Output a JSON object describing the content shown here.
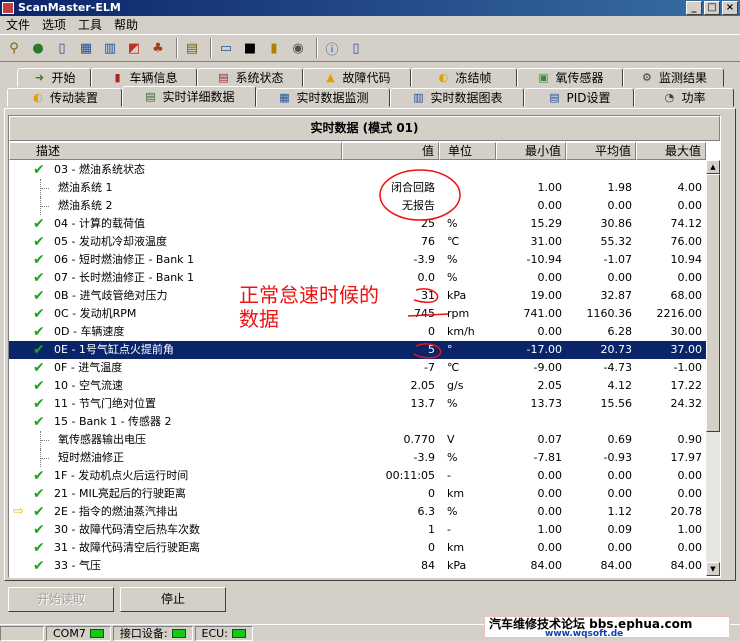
{
  "window": {
    "title": "ScanMaster-ELM",
    "minimize": "_",
    "maximize": "□",
    "close": "×"
  },
  "menu": [
    "文件",
    "选项",
    "工具",
    "帮助"
  ],
  "toolbar_icons": [
    "connect-icon",
    "globe-icon",
    "document-icon",
    "table-icon",
    "chart-icon",
    "tiles-icon",
    "engine-icon",
    "clipboard-icon",
    "monitor-icon",
    "terminal-icon",
    "battery-icon",
    "gauge-icon",
    "info-icon",
    "exit-icon"
  ],
  "tabs_row1": [
    {
      "label": "开始",
      "icon": "play-icon",
      "glyph": "➜",
      "color": "#3a7a2a"
    },
    {
      "label": "车辆信息",
      "icon": "info-card-icon",
      "glyph": "▮",
      "color": "#b02020"
    },
    {
      "label": "系统状态",
      "icon": "status-icon",
      "glyph": "▤",
      "color": "#b02020"
    },
    {
      "label": "故障代码",
      "icon": "warning-icon",
      "glyph": "▲",
      "color": "#e0a000"
    },
    {
      "label": "冻结帧",
      "icon": "freeze-frame-icon",
      "glyph": "◐",
      "color": "#e0a000"
    },
    {
      "label": "氧传感器",
      "icon": "sensor-icon",
      "glyph": "▣",
      "color": "#3a8a3a"
    },
    {
      "label": "监测结果",
      "icon": "monitor-result-icon",
      "glyph": "⚙",
      "color": "#404040"
    }
  ],
  "tabs_row2": [
    {
      "label": "传动装置",
      "icon": "transmission-icon",
      "glyph": "◐",
      "color": "#e0a000"
    },
    {
      "label": "实时详细数据",
      "icon": "list-icon",
      "glyph": "▤",
      "color": "#3a6a3a",
      "active": true
    },
    {
      "label": "实时数据监测",
      "icon": "grid-icon",
      "glyph": "▦",
      "color": "#2050a0"
    },
    {
      "label": "实时数据图表",
      "icon": "graph-icon",
      "glyph": "▥",
      "color": "#2050a0"
    },
    {
      "label": "PID设置",
      "icon": "pid-icon",
      "glyph": "▤",
      "color": "#2050a0"
    },
    {
      "label": "功率",
      "icon": "power-icon",
      "glyph": "◔",
      "color": "#404040"
    }
  ],
  "grid": {
    "title": "实时数据 (模式 01)",
    "headers": {
      "desc": "描述",
      "value": "值",
      "unit": "单位",
      "min": "最小值",
      "avg": "平均值",
      "max": "最大值"
    }
  },
  "rows": [
    {
      "desc": "03 - 燃油系统状态",
      "value": "",
      "unit": "",
      "min": "",
      "avg": "",
      "max": "",
      "check": true
    },
    {
      "desc": "燃油系统 1",
      "value": "闭合回路",
      "unit": "",
      "min": "1.00",
      "avg": "1.98",
      "max": "4.00",
      "child": true
    },
    {
      "desc": "燃油系统 2",
      "value": "无报告",
      "unit": "",
      "min": "0.00",
      "avg": "0.00",
      "max": "0.00",
      "child": true
    },
    {
      "desc": "04 - 计算的载荷值",
      "value": "25",
      "unit": "%",
      "min": "15.29",
      "avg": "30.86",
      "max": "74.12",
      "check": true
    },
    {
      "desc": "05 - 发动机冷却液温度",
      "value": "76",
      "unit": "℃",
      "min": "31.00",
      "avg": "55.32",
      "max": "76.00",
      "check": true
    },
    {
      "desc": "06 - 短时燃油修正 - Bank 1",
      "value": "-3.9",
      "unit": "%",
      "min": "-10.94",
      "avg": "-1.07",
      "max": "10.94",
      "check": true
    },
    {
      "desc": "07 - 长时燃油修正 - Bank 1",
      "value": "0.0",
      "unit": "%",
      "min": "0.00",
      "avg": "0.00",
      "max": "0.00",
      "check": true
    },
    {
      "desc": "0B - 进气歧管绝对压力",
      "value": "31",
      "unit": "kPa",
      "min": "19.00",
      "avg": "32.87",
      "max": "68.00",
      "check": true
    },
    {
      "desc": "0C - 发动机RPM",
      "value": "745",
      "unit": "rpm",
      "min": "741.00",
      "avg": "1160.36",
      "max": "2216.00",
      "check": true
    },
    {
      "desc": "0D - 车辆速度",
      "value": "0",
      "unit": "km/h",
      "min": "0.00",
      "avg": "6.28",
      "max": "30.00",
      "check": true
    },
    {
      "desc": "0E - 1号气缸点火提前角",
      "value": "5",
      "unit": "°",
      "min": "-17.00",
      "avg": "20.73",
      "max": "37.00",
      "check": true,
      "selected": true
    },
    {
      "desc": "0F - 进气温度",
      "value": "-7",
      "unit": "℃",
      "min": "-9.00",
      "avg": "-4.73",
      "max": "-1.00",
      "check": true
    },
    {
      "desc": "10 - 空气流速",
      "value": "2.05",
      "unit": "g/s",
      "min": "2.05",
      "avg": "4.12",
      "max": "17.22",
      "check": true
    },
    {
      "desc": "11 - 节气门绝对位置",
      "value": "13.7",
      "unit": "%",
      "min": "13.73",
      "avg": "15.56",
      "max": "24.32",
      "check": true
    },
    {
      "desc": "15 - Bank 1 - 传感器 2",
      "value": "",
      "unit": "",
      "min": "",
      "avg": "",
      "max": "",
      "check": true
    },
    {
      "desc": "氧传感器输出电压",
      "value": "0.770",
      "unit": "V",
      "min": "0.07",
      "avg": "0.69",
      "max": "0.90",
      "child": true
    },
    {
      "desc": "短时燃油修正",
      "value": "-3.9",
      "unit": "%",
      "min": "-7.81",
      "avg": "-0.93",
      "max": "17.97",
      "child": true
    },
    {
      "desc": "1F - 发动机点火后运行时间",
      "value": "00:11:05",
      "unit": "-",
      "min": "0.00",
      "avg": "0.00",
      "max": "0.00",
      "check": true
    },
    {
      "desc": "21 - MIL亮起后的行驶距离",
      "value": "0",
      "unit": "km",
      "min": "0.00",
      "avg": "0.00",
      "max": "0.00",
      "check": true
    },
    {
      "desc": "2E - 指令的燃油蒸汽排出",
      "value": "6.3",
      "unit": "%",
      "min": "0.00",
      "avg": "1.12",
      "max": "20.78",
      "check": true,
      "arrow": true
    },
    {
      "desc": "30 - 故障代码清空后热车次数",
      "value": "1",
      "unit": "-",
      "min": "1.00",
      "avg": "0.09",
      "max": "1.00",
      "check": true
    },
    {
      "desc": "31 - 故障代码清空后行驶距离",
      "value": "0",
      "unit": "km",
      "min": "0.00",
      "avg": "0.00",
      "max": "0.00",
      "check": true
    },
    {
      "desc": "33 - 气压",
      "value": "84",
      "unit": "kPa",
      "min": "84.00",
      "avg": "84.00",
      "max": "84.00",
      "check": true
    }
  ],
  "buttons": {
    "start": "开始读取",
    "stop": "停止"
  },
  "status": {
    "com_label": "COM7",
    "iface_label": "接口设备:",
    "ecu_label": "ECU:"
  },
  "annotation": {
    "text": "正常怠速时候的数据",
    "color": "#ee1111"
  },
  "watermark": {
    "main": "汽车维修技术论坛 bbs.ephua.com",
    "sub": "www.wqsoft.de"
  }
}
